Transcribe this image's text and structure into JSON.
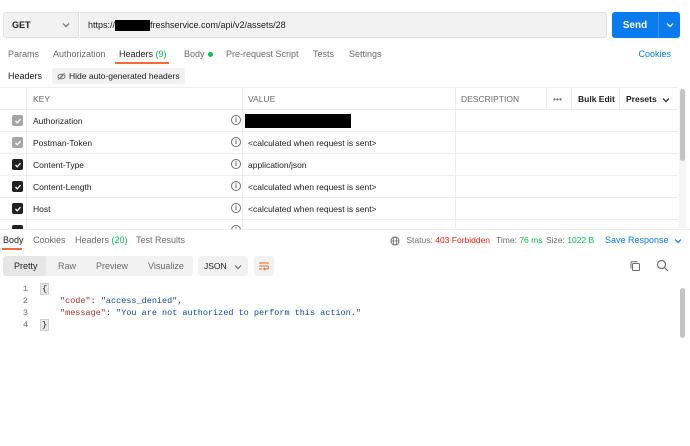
{
  "request": {
    "method": "GET",
    "url_prefix": "https://",
    "url_suffix": "freshservice.com/api/v2/assets/28",
    "send_label": "Send"
  },
  "request_tabs": [
    {
      "label": "Params"
    },
    {
      "label": "Authorization"
    },
    {
      "label": "Headers",
      "count": "(9)"
    },
    {
      "label": "Body"
    },
    {
      "label": "Pre-request Script"
    },
    {
      "label": "Tests"
    },
    {
      "label": "Settings"
    }
  ],
  "cookies_label": "Cookies",
  "headers_sub": {
    "label": "Headers",
    "hide_auto": "Hide auto-generated headers"
  },
  "table": {
    "columns": {
      "key": "KEY",
      "value": "VALUE",
      "description": "DESCRIPTION",
      "more": "•••",
      "bulk_edit": "Bulk Edit",
      "presets": "Presets"
    },
    "rows": [
      {
        "key": "Authorization",
        "value": "",
        "checkbox": "gray"
      },
      {
        "key": "Postman-Token",
        "value": "<calculated when request is sent>",
        "checkbox": "gray"
      },
      {
        "key": "Content-Type",
        "value": "application/json",
        "checkbox": "dark"
      },
      {
        "key": "Content-Length",
        "value": "<calculated when request is sent>",
        "checkbox": "dark"
      },
      {
        "key": "Host",
        "value": "<calculated when request is sent>",
        "checkbox": "dark"
      }
    ]
  },
  "response": {
    "tabs": [
      {
        "label": "Body"
      },
      {
        "label": "Cookies"
      },
      {
        "label": "Headers",
        "count": "(20)"
      },
      {
        "label": "Test Results"
      }
    ],
    "status_label": "Status:",
    "status_value": "403 Forbidden",
    "time_label": "Time:",
    "time_value": "76 ms",
    "size_label": "Size:",
    "size_value": "1022 B",
    "save_label": "Save Response",
    "view_modes": [
      "Pretty",
      "Raw",
      "Preview",
      "Visualize"
    ],
    "format": "JSON",
    "body_lines": [
      {
        "num": "1",
        "open": "{"
      },
      {
        "num": "2",
        "key": "\"code\"",
        "sep": ": ",
        "val": "\"access_denied\"",
        "end": ","
      },
      {
        "num": "3",
        "key": "\"message\"",
        "sep": ": ",
        "val": "\"You are not authorized to perform this action.\"",
        "end": ""
      },
      {
        "num": "4",
        "open": "}"
      }
    ]
  },
  "colors": {
    "accent": "#097bed",
    "active_tab": "#f26b3a",
    "status_error": "#eb2013",
    "success": "#0cbb52"
  }
}
